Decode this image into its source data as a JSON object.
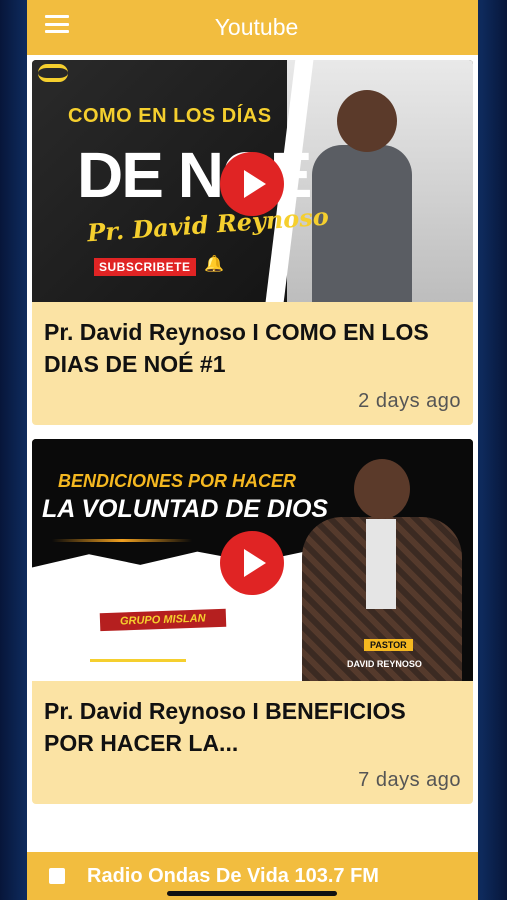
{
  "app_bar": {
    "title": "Youtube",
    "menu_icon": "hamburger-icon"
  },
  "videos": [
    {
      "thumbnail": {
        "line1": "COMO EN LOS DÍAS",
        "line2": "DE NOÉ",
        "line3": "Pr. David Reynoso",
        "subscribe": "SUBSCRIBETE"
      },
      "title": "Pr. David Reynoso I COMO EN LOS DIAS DE NOÉ  #1",
      "time": "2 days ago"
    },
    {
      "thumbnail": {
        "line1": "BENDICIONES POR HACER",
        "line2": "LA VOLUNTAD DE DIOS",
        "badge": "GRUPO MISLAN",
        "pastor_label": "PASTOR",
        "pastor_name": "DAVID REYNOSO"
      },
      "title": "Pr. David Reynoso I BENEFICIOS POR HACER LA...",
      "time": "7 days ago"
    }
  ],
  "player": {
    "label": "Radio Ondas De Vida 103.7 FM",
    "control_icon": "stop-icon"
  },
  "colors": {
    "accent": "#f2bd3f",
    "card": "#fbe3a4",
    "play": "#e02424",
    "background": "#0e2a5c"
  }
}
